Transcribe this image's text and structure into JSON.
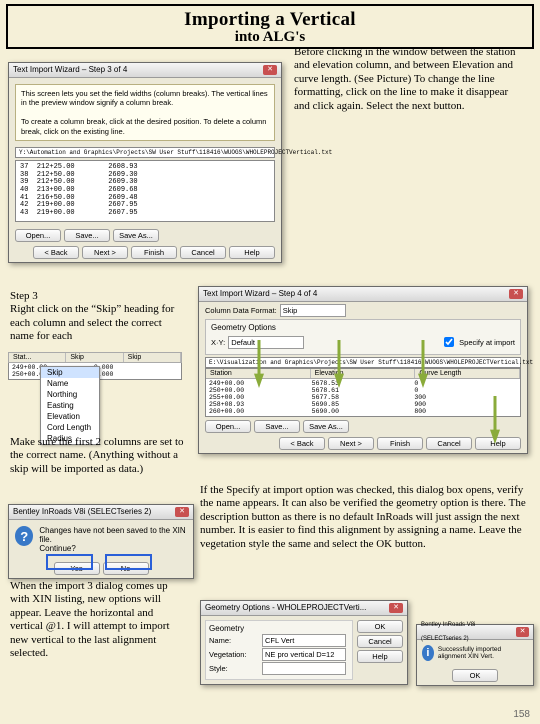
{
  "title": {
    "main": "Importing a Vertical",
    "sub": "into ALG's"
  },
  "w1": {
    "title": "Text Import Wizard – Step 3 of 4",
    "ivory": "This screen lets you set the field widths (column breaks). The vertical lines in the preview window signify a column break.\n\n   To create a column break, click at the desired position. To delete a column break, click on the existing line.",
    "path": "Y:\\Automation and Graphics\\Projects\\SW User Stuff\\118416\\WUOGS\\WHOLEPROJECTVertical.txt",
    "rows": [
      "37  212+25.00        2608.93",
      "38  212+50.00        2609.30",
      "39  212+50.00        2609.30",
      "40  213+00.00        2609.68",
      "41  216+50.00        2609.48",
      "42  219+00.00        2607.95",
      "43  219+00.00        2607.95"
    ],
    "btns": {
      "open": "Open...",
      "save": "Save...",
      "saveAs": "Save As...",
      "back": "< Back",
      "next": "Next >",
      "finish": "Finish",
      "cancel": "Cancel",
      "help": "Help"
    }
  },
  "step4": "Step 3\nRight click on the “Skip” heading for each column and select the correct name for each",
  "gridHead": {
    "c1": "Stat...",
    "c2": "Skip",
    "c3": "Skip"
  },
  "gridSamples": [
    "249+00.00            0.000",
    "250+00.00            0.000"
  ],
  "drop": [
    "Skip",
    "Name",
    "Northing",
    "Easting",
    "Elevation",
    "Cord Length",
    "Radius"
  ],
  "under1": "Make sure the first 2 columns are set to the correct name. (Anything without a skip will be imported as data.)",
  "w2": {
    "title": "Bentley InRoads V8i (SELECTseries 2)",
    "msg": "Changes have not been saved to the XIN file.\nContinue?",
    "yes": "Yes",
    "no": "No"
  },
  "under2": "When the import 3 dialog comes up with XIN listing, new options will appear. Leave the horizontal and vertical @1. I will attempt to import new vertical to the last alignment selected.",
  "rightP1": "Before clicking in the window between the station and elevation column, and between Elevation and curve length. (See Picture)\n\nTo change the line formatting, click on the line to make it disappear and click again. Select the next button.",
  "w3": {
    "title": "Text Import Wizard – Step 4 of 4",
    "cdf": "Column Data Format:",
    "cdfVal": "Skip",
    "go": "Geometry Options",
    "xorLbl": "X·Y:",
    "xorVal": "Default",
    "spec": "Specify at import",
    "path": "E:\\Visualization and Graphics\\Projects\\SW User Stuff\\118416\\WUOGS\\WHOLEPROJECTVertical.txt",
    "headers": [
      "Station",
      "Elevation",
      "Curve Length"
    ],
    "rows": [
      [
        "249+00.00",
        "5678.53",
        "0"
      ],
      [
        "250+00.00",
        "5678.61",
        "0"
      ],
      [
        "255+00.00",
        "5677.58",
        "300"
      ],
      [
        "258+08.93",
        "5690.85",
        "900"
      ],
      [
        "260+00.00",
        "5690.00",
        "800"
      ]
    ],
    "btns": {
      "open": "Open...",
      "save": "Save...",
      "saveAs": "Save As...",
      "back": "< Back",
      "next": "Next >",
      "finish": "Finish",
      "cancel": "Cancel",
      "help": "Help"
    }
  },
  "rightP2": "If the Specify at import option was checked, this dialog box opens, verify the name appears. It can also be verified the geometry option is there. The description button as there is no default InRoads will just assign the next number. It is easier to find this alignment by assigning a name. Leave the vegetation style the same and select the OK button.",
  "w4": {
    "title": "Geometry Options - WHOLEPROJECTVerti...",
    "geom": "Geometry",
    "name": "Name:",
    "nameVal": "CFL Vert",
    "veg": "Vegetation:",
    "vegVal": "NE pro vertical D=12",
    "style": "Style:",
    "ok": "OK",
    "cancel": "Cancel",
    "help": "Help"
  },
  "w5": {
    "title": "Bentley InRoads V8i (SELECTseries 2)",
    "msg": "Successfully imported alignment XIN Vert.",
    "ok": "OK"
  },
  "page": "158"
}
